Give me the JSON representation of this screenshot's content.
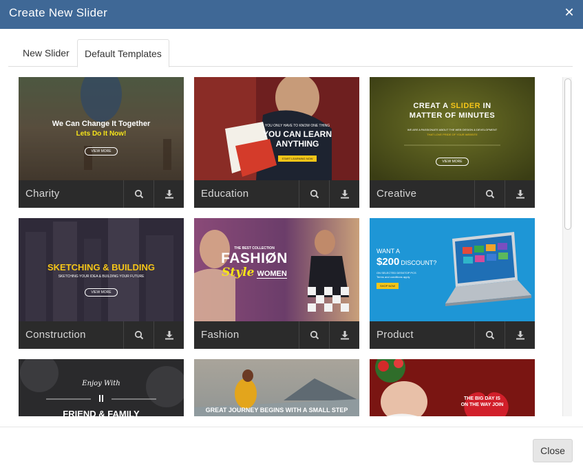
{
  "dialog": {
    "title": "Create New Slider",
    "close_symbol": "✕",
    "close_button_label": "Close"
  },
  "tabs": [
    {
      "label": "New Slider",
      "active": false
    },
    {
      "label": "Default Templates",
      "active": true
    }
  ],
  "templates": [
    {
      "name": "Charity",
      "line1": "We Can Change It Together",
      "line2": "Lets Do It Now!",
      "button": "VIEW MORE"
    },
    {
      "name": "Education",
      "line1": "YOU ONLY HAVE TO KNOW ONE THING",
      "line2": "YOU CAN LEARN",
      "line3": "ANYTHING",
      "button": "START LEARNING NOW"
    },
    {
      "name": "Creative",
      "line1a": "CREAT A ",
      "line1b": "SLIDER",
      "line1c": " IN",
      "line2": "MATTER OF MINUTES",
      "line3": "WE ARE A PASSIONATE ABOUT THE WEB DESIGN & DEVELOPMENT",
      "line4": "THAT LOVE PRIDE OF YOUR WEBSITE",
      "button": "VIEW MORE"
    },
    {
      "name": "Construction",
      "line1": "SKETCHING & BUILDING",
      "line2": "SKETCHING YOUR IDEA & BUILDING YOUR FUTURE",
      "button": "VIEW MORE"
    },
    {
      "name": "Fashion",
      "line1": "THE BEST COLLECTION",
      "line2": "FASHIØN",
      "line3": "Style",
      "line4": "WOMEN"
    },
    {
      "name": "Product",
      "line1": "WANT A",
      "line2": "$200",
      "line3": "DISCOUNT?",
      "line4": "ON SELECTED DESKTOP PCS",
      "line5": "Terms and conditions apply",
      "button": "SHOP NOW"
    },
    {
      "line1": "Enjoy With",
      "line2": "FRIEND & FAMILY"
    },
    {
      "line1": "GREAT JOURNEY BEGINS WITH A SMALL STEP"
    },
    {
      "line1": "THE BIG DAY IS",
      "line2": "ON THE WAY JOIN"
    }
  ],
  "icons": {
    "preview": "magnifier-icon",
    "install": "download-icon"
  },
  "colors": {
    "titlebar": "#3f6896",
    "card_footer": "#2b2b2b",
    "accent_yellow": "#f5c518"
  }
}
